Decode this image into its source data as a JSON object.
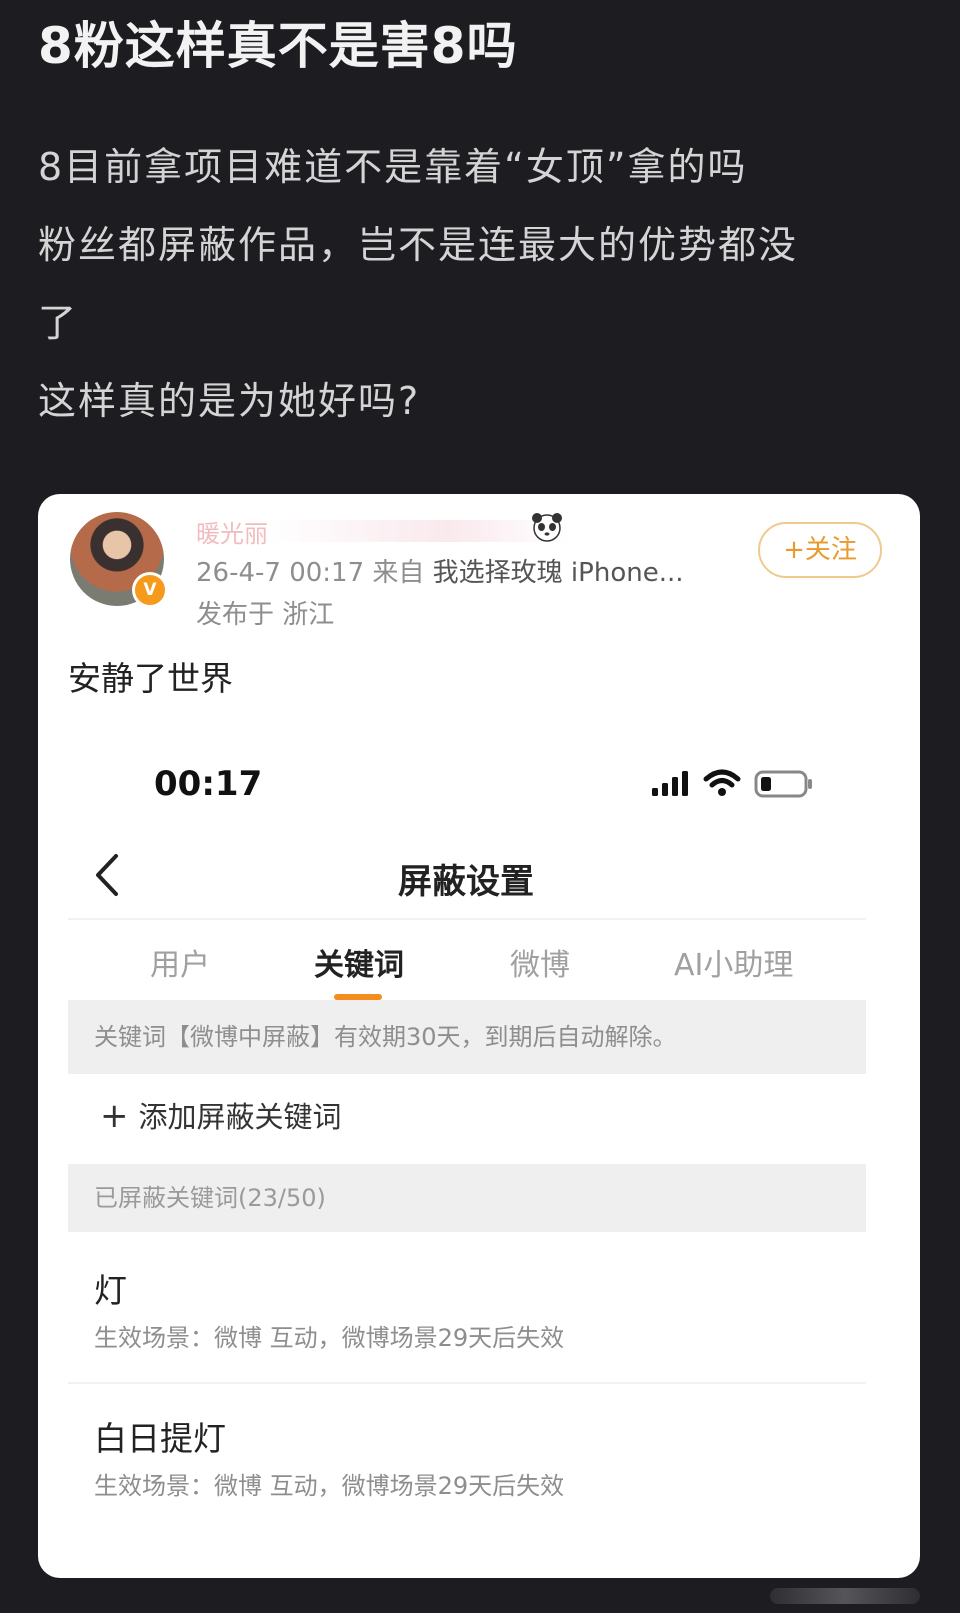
{
  "post": {
    "title": "8粉这样真不是害8吗",
    "lines": [
      "8目前拿项目难道不是靠着“女顶”拿的吗",
      "粉丝都屏蔽作品，岂不是连最大的优势都没",
      "了",
      "这样真的是为她好吗?"
    ]
  },
  "weibo_card": {
    "username_partial": "暖光丽",
    "badge": "V",
    "meta_time": "26-4-7 00:17",
    "meta_from": "来自",
    "meta_source": "我选择玫瑰 iPhone...",
    "location": "发布于 浙江",
    "follow_label": "+关注",
    "status_text": "安静了世界",
    "icons": {
      "avatar": "avatar",
      "verify": "verified-badge-icon",
      "emoji": "panda-icon",
      "signal": "signal-icon",
      "wifi": "wifi-icon",
      "battery": "battery-icon",
      "back": "back-chevron-icon"
    }
  },
  "phone": {
    "time": "00:17",
    "nav_title": "屏蔽设置",
    "tabs": [
      "用户",
      "关键词",
      "微博",
      "AI小助理"
    ],
    "active_tab_index": 1,
    "notice": "关键词【微博中屏蔽】有效期30天，到期后自动解除。",
    "add_label": "添加屏蔽关键词",
    "add_symbol": "+",
    "section_header": "已屏蔽关键词(23/50)",
    "keywords": [
      {
        "title": "灯",
        "desc": "生效场景：微博 互动，微博场景29天后失效"
      },
      {
        "title": "白日提灯",
        "desc": "生效场景：微博 互动，微博场景29天后失效"
      }
    ]
  },
  "colors": {
    "background": "#1d1c21",
    "accent_orange": "#f58c1e",
    "follow_border": "#f0c98d"
  }
}
